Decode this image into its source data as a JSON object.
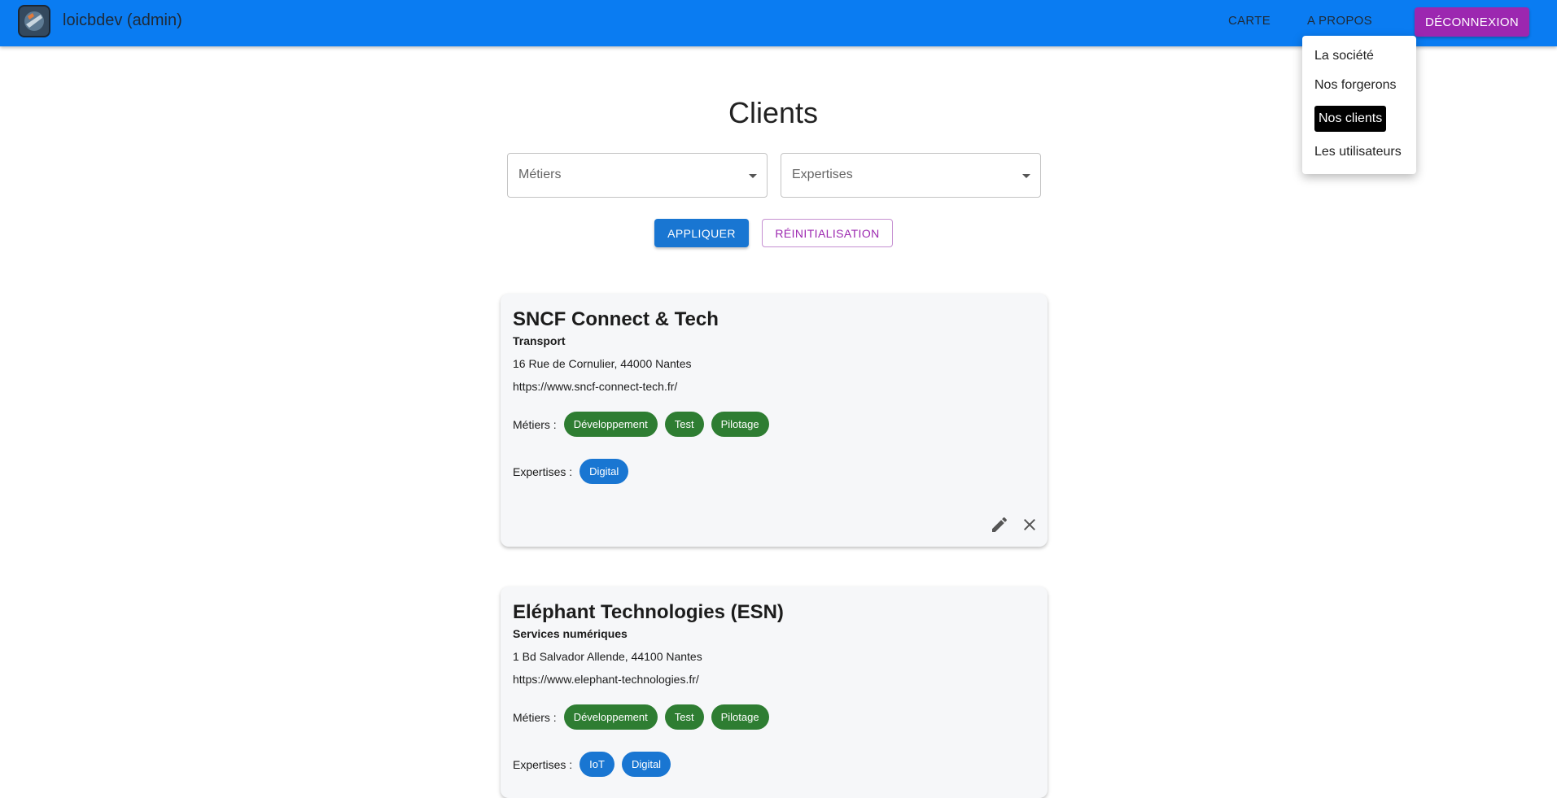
{
  "appbar": {
    "title": "loicbdev (admin)",
    "nav": {
      "map": "CARTE",
      "about": "A PROPOS"
    },
    "logout": "DÉCONNEXION"
  },
  "about_menu": {
    "items": [
      {
        "label": "La société"
      },
      {
        "label": "Nos forgerons"
      },
      {
        "label": "Nos clients",
        "active": true
      },
      {
        "label": "Les utilisateurs"
      }
    ]
  },
  "page": {
    "title": "Clients"
  },
  "filters": {
    "trades": {
      "placeholder": "Métiers"
    },
    "expertises": {
      "placeholder": "Expertises"
    },
    "apply": "APPLIQUER",
    "reset": "RÉINITIALISATION"
  },
  "labels": {
    "trades": "Métiers :",
    "expertises": "Expertises :"
  },
  "clients": [
    {
      "name": "SNCF Connect & Tech",
      "sector": "Transport",
      "address": "16 Rue de Cornulier, 44000 Nantes",
      "url": "https://www.sncf-connect-tech.fr/",
      "trades": [
        "Développement",
        "Test",
        "Pilotage"
      ],
      "expertises": [
        "Digital"
      ]
    },
    {
      "name": "Eléphant Technologies (ESN)",
      "sector": "Services numériques",
      "address": "1 Bd Salvador Allende, 44100 Nantes",
      "url": "https://www.elephant-technologies.fr/",
      "trades": [
        "Développement",
        "Test",
        "Pilotage"
      ],
      "expertises": [
        "IoT",
        "Digital"
      ]
    }
  ],
  "colors": {
    "appbar": "#0a7cf2",
    "logout": "#9c27b0",
    "apply": "#1976d2",
    "trade_chip": "#2e7d32",
    "expertise_chip": "#1976d2"
  },
  "icons": {
    "edit": "pencil-icon",
    "delete": "close-icon"
  }
}
